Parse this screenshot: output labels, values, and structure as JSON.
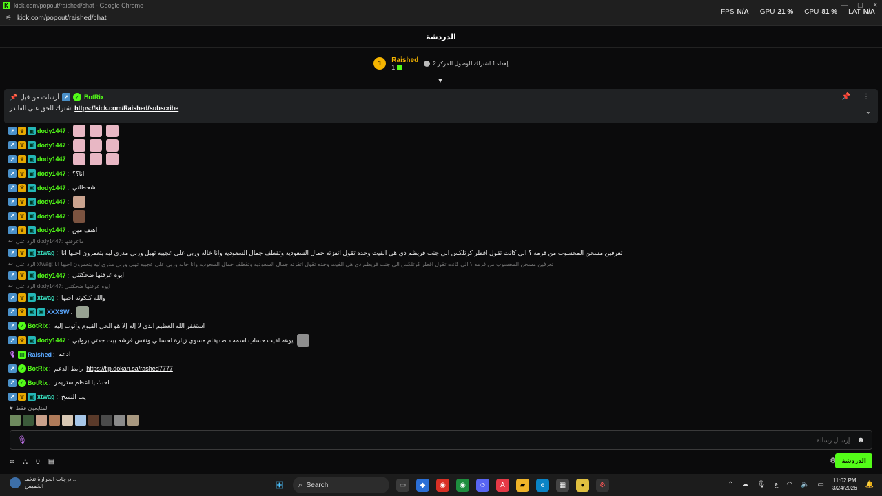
{
  "window": {
    "title": "kick.com/popout/raished/chat - Google Chrome",
    "url": "kick.com/popout/raished/chat"
  },
  "hud": {
    "fps_label": "FPS",
    "fps_value": "N/A",
    "gpu_label": "GPU",
    "gpu_value": "21 %",
    "cpu_label": "CPU",
    "cpu_value": "81 %",
    "lat_label": "LAT",
    "lat_value": "N/A"
  },
  "chat": {
    "title": "الدردشة"
  },
  "top_gifter": {
    "rank": "1",
    "name": "Raished",
    "count": "1",
    "gift_text": "إهداء 1 اشتراك للوصول للمركز 2"
  },
  "pinned": {
    "prefix": "أرسلت من قبل",
    "user": "BotRix",
    "text": "اشترك للحق على الفاندر",
    "link": "https://kick.com/Raished/subscribe"
  },
  "messages": [
    {
      "type": "msg",
      "badges": [
        "blue",
        "crown",
        "sub"
      ],
      "user": "dody1447",
      "color": "green",
      "text": "",
      "emotes": [
        "pink",
        "pink",
        "pink"
      ]
    },
    {
      "type": "msg",
      "badges": [
        "blue",
        "crown",
        "sub"
      ],
      "user": "dody1447",
      "color": "green",
      "text": "",
      "emotes": [
        "pink",
        "pink",
        "pink"
      ]
    },
    {
      "type": "msg",
      "badges": [
        "blue",
        "crown",
        "sub"
      ],
      "user": "dody1447",
      "color": "green",
      "text": "",
      "emotes": [
        "pink",
        "pink",
        "pink"
      ]
    },
    {
      "type": "msg",
      "badges": [
        "blue",
        "crown",
        "sub"
      ],
      "user": "dody1447",
      "color": "green",
      "text": "انا؟؟",
      "emotes": []
    },
    {
      "type": "msg",
      "badges": [
        "blue",
        "crown",
        "sub"
      ],
      "user": "dody1447",
      "color": "green",
      "text": "شحطاني",
      "emotes": []
    },
    {
      "type": "msg",
      "badges": [
        "blue",
        "crown",
        "sub"
      ],
      "user": "dody1447",
      "color": "green",
      "text": "",
      "emotes": [
        "face"
      ]
    },
    {
      "type": "msg",
      "badges": [
        "blue",
        "crown",
        "sub"
      ],
      "user": "dody1447",
      "color": "green",
      "text": "",
      "emotes": [
        "dark"
      ]
    },
    {
      "type": "msg",
      "badges": [
        "blue",
        "crown",
        "sub"
      ],
      "user": "dody1447",
      "color": "green",
      "text": "اهتف مين",
      "emotes": []
    },
    {
      "type": "reply",
      "text": "الرد على dody1447: ماعرفتها"
    },
    {
      "type": "msg",
      "badges": [
        "blue",
        "crown",
        "sub"
      ],
      "user": "xtwag",
      "color": "teal",
      "text": "تعرفين مسحن المحسوب من فرمه ؟ الي كانت تقول اقطر كرتلكس الي جنب فريظم ذي هي الفيت وحده تقول اتفزته جمال السعوديه وتقطف جمال السعوديه وانا خاله وربي على عجيبه تهبل وربي مدري ليه يتعمرون احبها انا",
      "emotes": []
    },
    {
      "type": "reply",
      "text": "الرد على xtwag: تعرفين مسحن المحسوب من فرمه ؟ الي كانت تقول اقطر كرتلكس الي جنب فريظم ذي هي الفيت وحده تقول اتفزته جمال السعوديه وتقطف جمال السعوديه وانا خاله وربي على عجيبه تهبل وربي مدري ليه يتعمرون احبها انا"
    },
    {
      "type": "msg",
      "badges": [
        "blue",
        "crown",
        "sub"
      ],
      "user": "dody1447",
      "color": "green",
      "text": "ايوه عرفتها ضحكتني",
      "emotes": []
    },
    {
      "type": "reply",
      "text": "الرد على dody1447: ايوه عرفتها ضحكتني"
    },
    {
      "type": "msg",
      "badges": [
        "blue",
        "crown",
        "sub"
      ],
      "user": "xtwag",
      "color": "teal",
      "text": "والله كلكوته احبها",
      "emotes": []
    },
    {
      "type": "msg",
      "badges": [
        "blue",
        "crown",
        "sub",
        "sub"
      ],
      "user": "XXXSW",
      "color": "blue",
      "text": "",
      "emotes": [
        "grey"
      ]
    },
    {
      "type": "msg",
      "badges": [
        "blue",
        "green"
      ],
      "user": "BotRix",
      "color": "green",
      "text": "استغفر الله العظيم الذي لا إله إلا هو الحي القيوم وأتوب إليه",
      "emotes": []
    },
    {
      "type": "msg",
      "badges": [
        "blue",
        "crown",
        "sub"
      ],
      "user": "dody1447",
      "color": "green",
      "text": "يوهه لقيت حساب اسمه د صديقام مسوي زيارة لحسابي ونفس فرشه بيت جدتي بروابي",
      "emotes": [
        "meme"
      ]
    },
    {
      "type": "msg",
      "badges": [
        "mic",
        "grn2"
      ],
      "user": "Raished",
      "color": "blue",
      "text": "دعم!",
      "emotes": []
    },
    {
      "type": "msg",
      "badges": [
        "blue",
        "green"
      ],
      "user": "BotRix",
      "color": "green",
      "text": "رابط الدعم",
      "link": "https://tip.dokan.sa/rashed7777",
      "emotes": []
    },
    {
      "type": "msg",
      "badges": [
        "blue",
        "green"
      ],
      "user": "BotRix",
      "color": "green",
      "text": "احبك يا اعظم ستريمر",
      "emotes": []
    },
    {
      "type": "msg",
      "badges": [
        "blue",
        "crown",
        "sub"
      ],
      "user": "xtwag",
      "color": "teal",
      "text": "يب النسخ",
      "emotes": []
    }
  ],
  "viewers": {
    "label": "المتابعون فقط"
  },
  "input": {
    "placeholder": "إرسال رسالة"
  },
  "bottom": {
    "points": "0",
    "send_label": "الدردشة"
  },
  "taskbar": {
    "weather_line1": "درجات الحرارة تنخفـ...",
    "weather_line2": "الخميس",
    "search_label": "Search",
    "time": "11:02 PM",
    "date": "3/24/2026",
    "lang": "ع"
  }
}
